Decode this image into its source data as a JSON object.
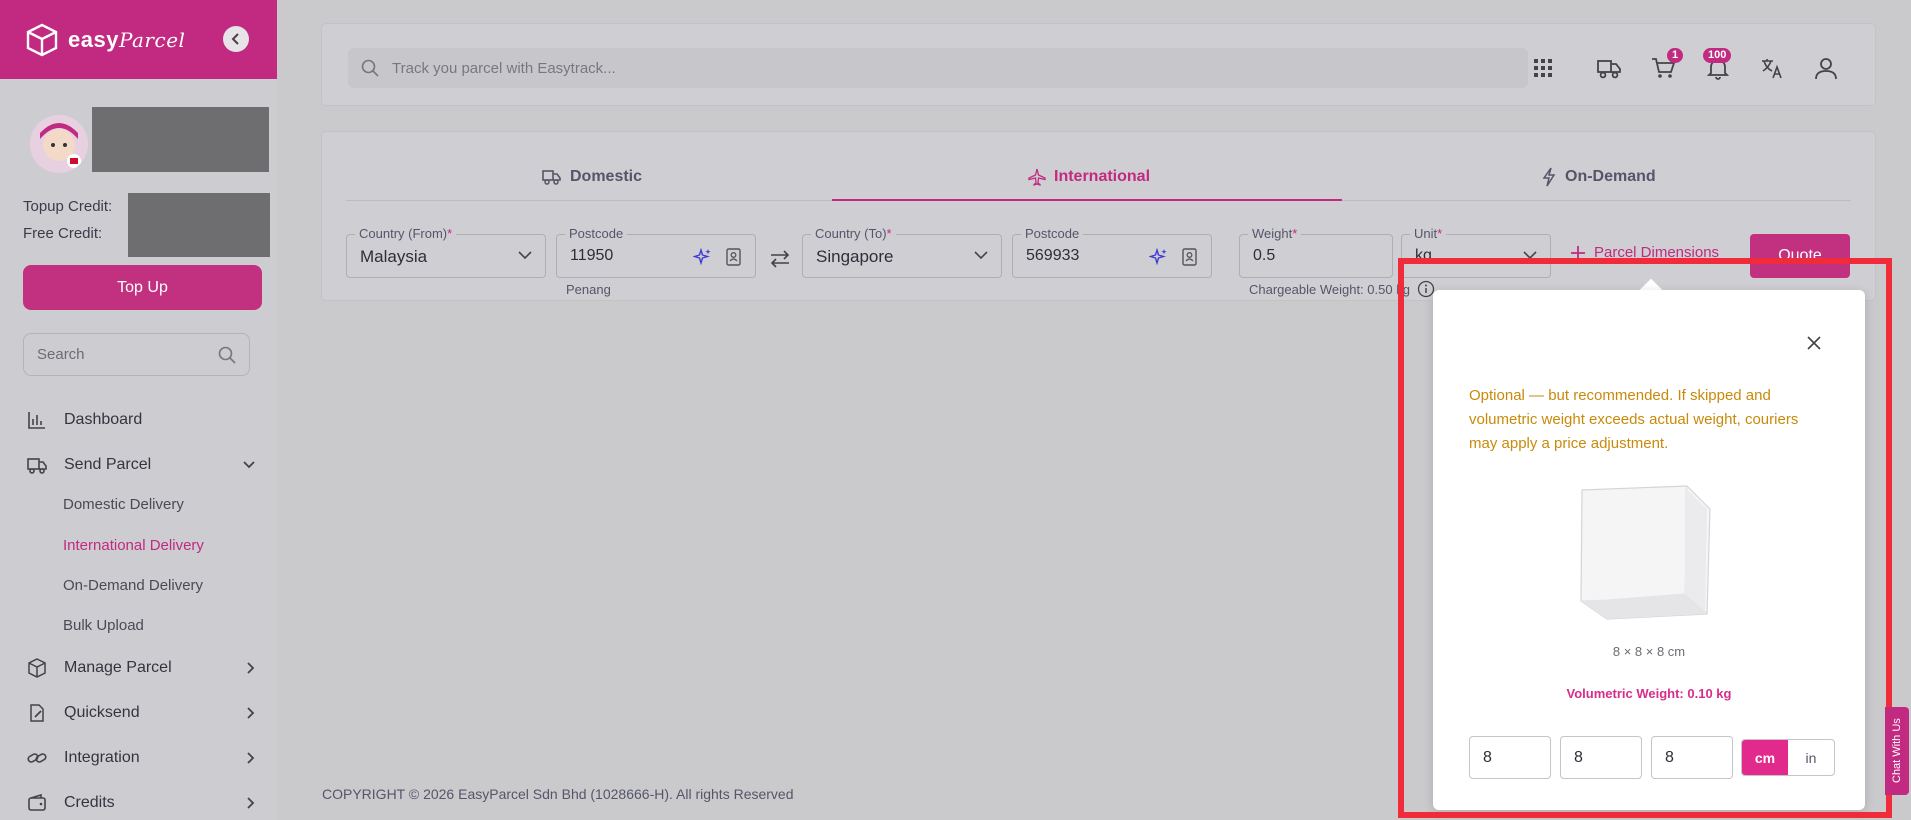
{
  "brand": {
    "name": "easy",
    "script": "Parcel"
  },
  "sidebar": {
    "topup_credit_label": "Topup Credit:",
    "free_credit_label": "Free Credit:",
    "topup_button": "Top Up",
    "search_placeholder": "Search",
    "items": [
      {
        "label": "Dashboard",
        "icon": "chart-icon"
      },
      {
        "label": "Send Parcel",
        "icon": "truck-icon",
        "expanded": true
      },
      {
        "label": "Manage Parcel",
        "icon": "box-icon"
      },
      {
        "label": "Quicksend",
        "icon": "document-edit-icon"
      },
      {
        "label": "Integration",
        "icon": "link-icon"
      },
      {
        "label": "Credits",
        "icon": "wallet-icon"
      }
    ],
    "sub_items": [
      {
        "label": "Domestic Delivery"
      },
      {
        "label": "International Delivery",
        "active": true
      },
      {
        "label": "On-Demand Delivery"
      },
      {
        "label": "Bulk Upload"
      }
    ]
  },
  "topbar": {
    "track_placeholder": "Track you parcel with Easytrack...",
    "cart_badge": "1",
    "notification_badge": "100"
  },
  "tabs": [
    {
      "label": "Domestic"
    },
    {
      "label": "International",
      "active": true
    },
    {
      "label": "On-Demand"
    }
  ],
  "form": {
    "country_from": {
      "label": "Country (From)",
      "value": "Malaysia"
    },
    "postcode_from": {
      "label": "Postcode",
      "value": "11950",
      "hint": "Penang"
    },
    "country_to": {
      "label": "Country (To)",
      "value": "Singapore"
    },
    "postcode_to": {
      "label": "Postcode",
      "value": "569933"
    },
    "weight": {
      "label": "Weight",
      "value": "0.5",
      "hint": "Chargeable Weight: 0.50 kg"
    },
    "unit": {
      "label": "Unit",
      "value": "kg"
    },
    "parcel_dimensions": "Parcel Dimensions",
    "quote_button": "Quote"
  },
  "popover": {
    "note": "Optional — but recommended. If skipped and volumetric weight exceeds actual weight, couriers may apply a price adjustment.",
    "dims_label": "8 × 8 × 8 cm",
    "volumetric": "Volumetric Weight: 0.10 kg",
    "length": "8",
    "width": "8",
    "height": "8",
    "unit_cm": "cm",
    "unit_in": "in",
    "selected_unit": "cm"
  },
  "footer": "COPYRIGHT © 2026 EasyParcel Sdn Bhd (1028666-H). All rights Reserved",
  "chat_label": "Chat With Us",
  "colors": {
    "brand": "#c12a80",
    "warning": "#c98a0b",
    "highlight": "#f02b3a"
  }
}
